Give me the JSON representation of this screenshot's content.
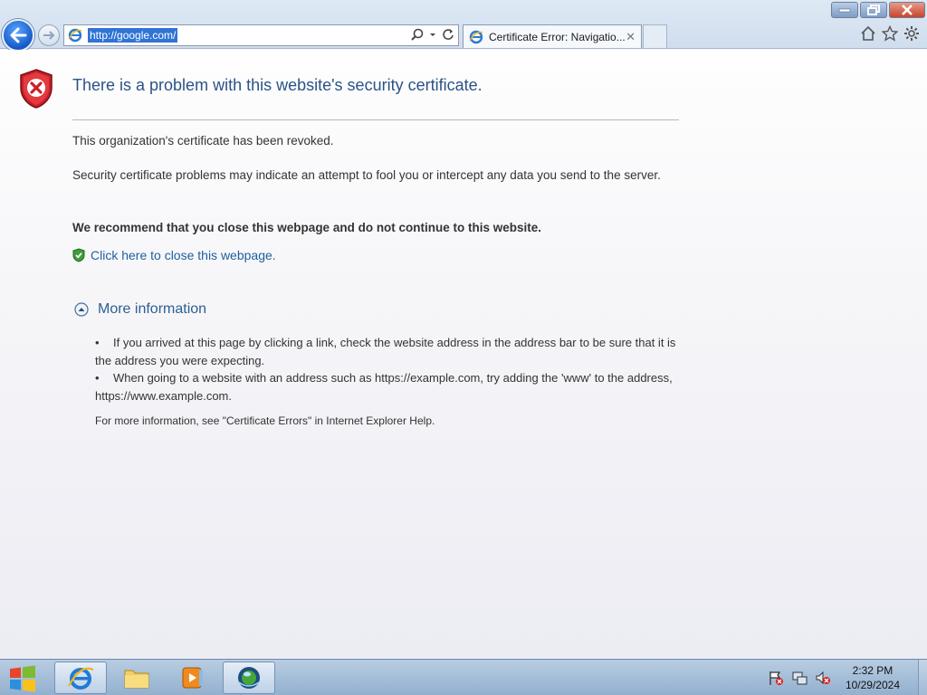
{
  "browser": {
    "address_url": "http://google.com/",
    "tab_title": "Certificate Error: Navigatio...",
    "icons": [
      "back-arrow-icon",
      "forward-arrow-icon",
      "ie-logo-icon",
      "search-icon",
      "dropdown-icon",
      "refresh-icon",
      "tab-close-icon",
      "home-icon",
      "favorites-star-icon",
      "settings-gear-icon"
    ]
  },
  "error_page": {
    "heading": "There is a problem with this website's security certificate.",
    "line1": "This organization's certificate has been revoked.",
    "line2": "Security certificate problems may indicate an attempt to fool you or intercept any data you send to the server.",
    "recommend": "We recommend that you close this webpage and do not continue to this website.",
    "close_link": "Click here to close this webpage.",
    "more_info_label": "More information",
    "bullets": [
      "If you arrived at this page by clicking a link, check the website address in the address bar to be sure that it is the address you were expecting.",
      "When going to a website with an address such as https://example.com, try adding the 'www' to the address, https://www.example.com."
    ],
    "footer": "For more information, see \"Certificate Errors\" in Internet Explorer Help."
  },
  "taskbar": {
    "time": "2:32 PM",
    "date": "10/29/2024",
    "pinned": [
      "internet-explorer",
      "file-explorer",
      "media-player",
      "network-app"
    ]
  },
  "colors": {
    "heading": "#2c5287",
    "link": "#1f5f9e",
    "selection": "#3173d6"
  }
}
